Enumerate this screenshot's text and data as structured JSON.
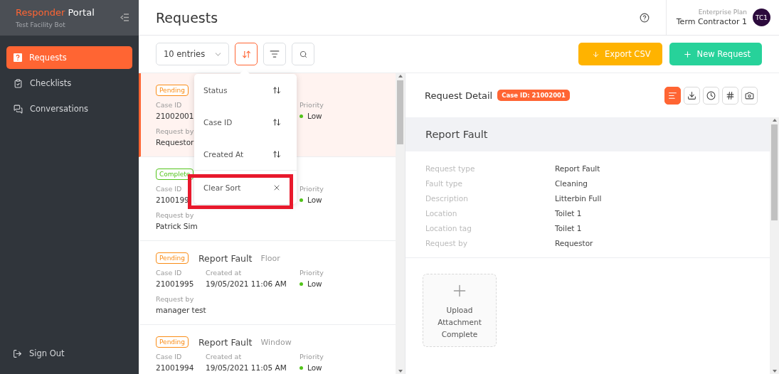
{
  "sidebar": {
    "brand_accent": "Responder",
    "brand_rest": "Portal",
    "subtitle": "Test Facility Bot",
    "items": [
      {
        "label": "Requests",
        "kind": "requests",
        "selected": true
      },
      {
        "label": "Checklists",
        "kind": "checklists",
        "selected": false
      },
      {
        "label": "Conversations",
        "kind": "conversations",
        "selected": false
      }
    ],
    "sign_out": "Sign Out"
  },
  "header": {
    "title": "Requests",
    "plan": "Enterprise Plan",
    "user": "Term Contractor 1",
    "avatar": "TC1"
  },
  "toolbar": {
    "entries": "10 entries",
    "sort_open": true,
    "export": "Export CSV",
    "new_request": "New Request"
  },
  "sort_menu": {
    "items": [
      {
        "label": "Status",
        "kind": "sort"
      },
      {
        "label": "Case ID",
        "kind": "sort"
      },
      {
        "label": "Created At",
        "kind": "sort"
      },
      {
        "label": "Clear Sort",
        "kind": "clear",
        "highlighted": true
      }
    ]
  },
  "requests": [
    {
      "status": "Pending",
      "color": "#fa8c16",
      "selected": true,
      "case_label": "Case ID",
      "case_id": "21002001",
      "priority_label": "Priority",
      "priority": "Low",
      "request_by_label": "Request by",
      "request_by": "Requestor"
    },
    {
      "status": "Complete",
      "color": "#52c41a",
      "selected": false,
      "case_label": "Case ID",
      "case_id": "2100199",
      "priority_label": "Priority",
      "priority": "Low",
      "request_by_label": "Request by",
      "request_by": "Patrick Sim"
    },
    {
      "status": "Pending",
      "color": "#fa8c16",
      "selected": false,
      "title": "Report Fault",
      "category": "Floor",
      "case_label": "Case ID",
      "case_id": "21001995",
      "created_label": "Created at",
      "created_at": "19/05/2021 11:06 AM",
      "priority_label": "Priority",
      "priority": "Low",
      "request_by_label": "Request by",
      "request_by": "manager test"
    },
    {
      "status": "Pending",
      "color": "#fa8c16",
      "selected": false,
      "title": "Report Fault",
      "category": "Window",
      "case_label": "Case ID",
      "case_id": "21001994",
      "created_label": "Created at",
      "created_at": "19/05/2021 11:05 AM",
      "priority_label": "Priority",
      "priority": "Low"
    }
  ],
  "detail": {
    "title": "Request Detail",
    "case_badge": "Case ID: 21002001",
    "tabs": [
      {
        "kind": "details",
        "selected": true
      },
      {
        "kind": "download",
        "selected": false
      },
      {
        "kind": "history",
        "selected": false
      },
      {
        "kind": "tags",
        "selected": false
      },
      {
        "kind": "photos",
        "selected": false
      }
    ],
    "section_title": "Report Fault",
    "fields": [
      {
        "label": "Request type",
        "value": "Report Fault"
      },
      {
        "label": "Fault type",
        "value": "Cleaning"
      },
      {
        "label": "Description",
        "value": "Litterbin Full"
      },
      {
        "label": "Location",
        "value": "Toilet 1"
      },
      {
        "label": "Location tag",
        "value": "Toilet 1"
      },
      {
        "label": "Request by",
        "value": "Requestor"
      }
    ],
    "upload": "Upload Attachment Complete"
  }
}
